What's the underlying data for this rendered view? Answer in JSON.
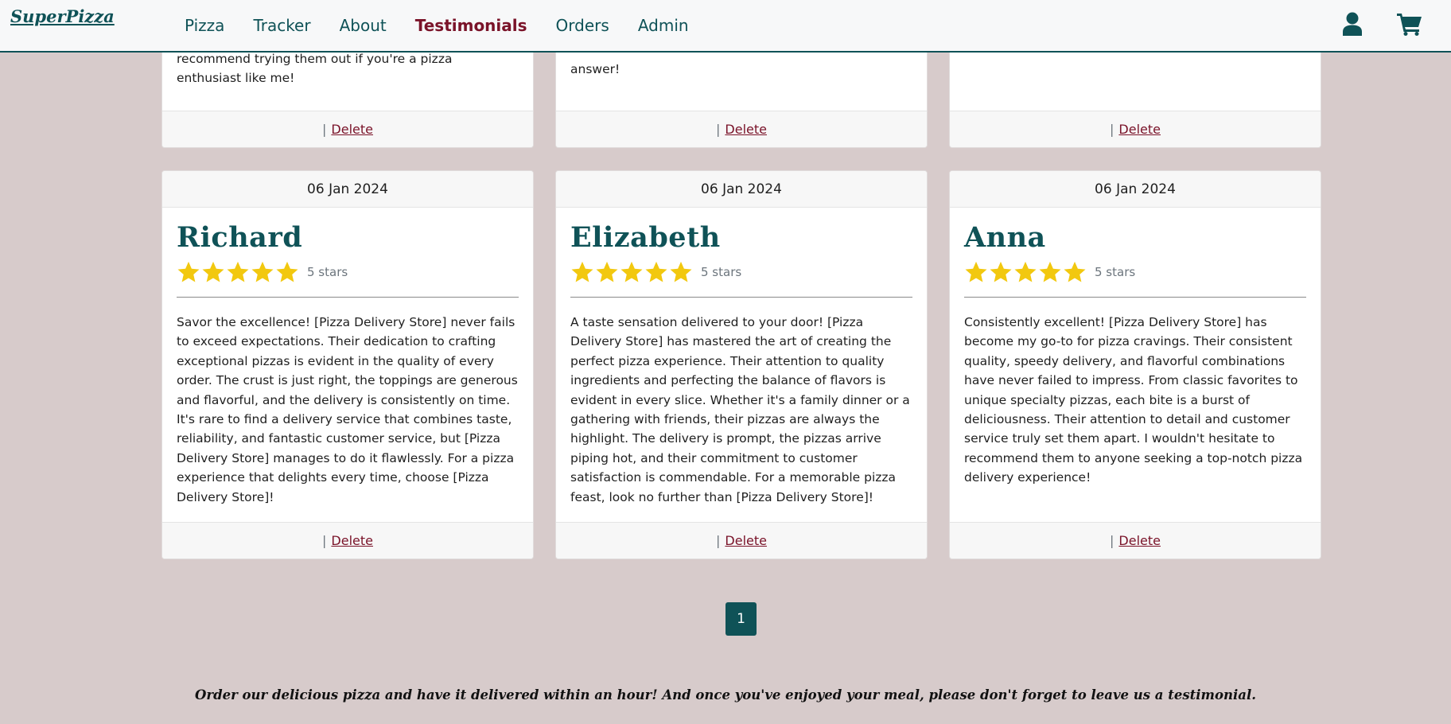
{
  "brand": "SuperPizza",
  "nav": {
    "items": [
      "Pizza",
      "Tracker",
      "About",
      "Testimonials",
      "Orders",
      "Admin"
    ],
    "active": "Testimonials"
  },
  "icons": {
    "user": "user-icon",
    "cart": "shopping-cart-icon",
    "star": "star-icon"
  },
  "colors": {
    "primary": "#0f5257",
    "accent": "#7a1329",
    "star": "#f2c80f",
    "background": "#d7cbcb"
  },
  "top_cards": [
    {
      "visible_text": "recommend trying them out if you're a pizza enthusiast like me!",
      "separator": "|",
      "delete_label": "Delete"
    },
    {
      "visible_text": "answer!",
      "separator": "|",
      "delete_label": "Delete"
    },
    {
      "visible_text": "",
      "separator": "|",
      "delete_label": "Delete"
    }
  ],
  "testimonials": [
    {
      "date": "06 Jan 2024",
      "name": "Richard",
      "stars": 5,
      "stars_label": "5 stars",
      "text": "Savor the excellence! [Pizza Delivery Store] never fails to exceed expectations. Their dedication to crafting exceptional pizzas is evident in the quality of every order. The crust is just right, the toppings are generous and flavorful, and the delivery is consistently on time. It's rare to find a delivery service that combines taste, reliability, and fantastic customer service, but [Pizza Delivery Store] manages to do it flawlessly. For a pizza experience that delights every time, choose [Pizza Delivery Store]!",
      "separator": "|",
      "delete_label": "Delete"
    },
    {
      "date": "06 Jan 2024",
      "name": "Elizabeth",
      "stars": 5,
      "stars_label": "5 stars",
      "text": "A taste sensation delivered to your door! [Pizza Delivery Store] has mastered the art of creating the perfect pizza experience. Their attention to quality ingredients and perfecting the balance of flavors is evident in every slice. Whether it's a family dinner or a gathering with friends, their pizzas are always the highlight. The delivery is prompt, the pizzas arrive piping hot, and their commitment to customer satisfaction is commendable. For a memorable pizza feast, look no further than [Pizza Delivery Store]!",
      "separator": "|",
      "delete_label": "Delete"
    },
    {
      "date": "06 Jan 2024",
      "name": "Anna",
      "stars": 5,
      "stars_label": "5 stars",
      "text": "Consistently excellent! [Pizza Delivery Store] has become my go-to for pizza cravings. Their consistent quality, speedy delivery, and flavorful combinations have never failed to impress. From classic favorites to unique specialty pizzas, each bite is a burst of deliciousness. Their attention to detail and customer service truly set them apart. I wouldn't hesitate to recommend them to anyone seeking a top-notch pizza delivery experience!",
      "separator": "|",
      "delete_label": "Delete"
    }
  ],
  "pagination": {
    "current": "1"
  },
  "footer_note": "Order our delicious pizza and have it delivered within an hour! And once you've enjoyed your meal, please don't forget to leave us a testimonial."
}
